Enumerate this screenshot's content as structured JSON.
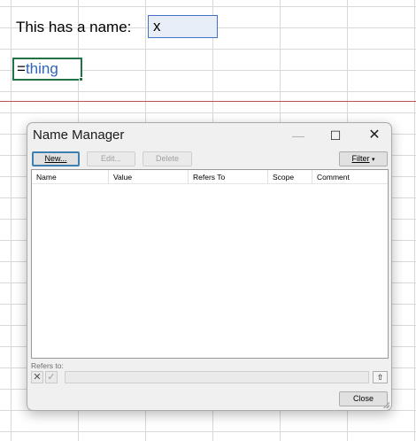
{
  "sheet": {
    "label_cell": "This has a name:",
    "value_cell": "x",
    "formula_eq": "=",
    "formula_ref": "thing"
  },
  "dialog": {
    "title": "Name Manager",
    "minimize_glyph": "—",
    "maximize_glyph": "☐",
    "close_glyph": "✕",
    "buttons": {
      "new": "New...",
      "edit": "Edit...",
      "delete": "Delete",
      "filter": "Filter",
      "close": "Close"
    },
    "columns": [
      "Name",
      "Value",
      "Refers To",
      "Scope",
      "Comment"
    ],
    "refers_to_label": "Refers to:",
    "refers_to_value": "",
    "icons": {
      "cancel": "cancel-x-icon",
      "accept": "checkmark-icon",
      "collapse": "collapse-dialog-icon",
      "filter": "chevron-down-icon"
    },
    "colors": {
      "selected_cell_fill": "#e8eef8",
      "selected_cell_border": "#4472c4",
      "active_cell_border": "#217346",
      "reference_text": "#2f64b8",
      "page_break_line": "#c0504d"
    }
  }
}
